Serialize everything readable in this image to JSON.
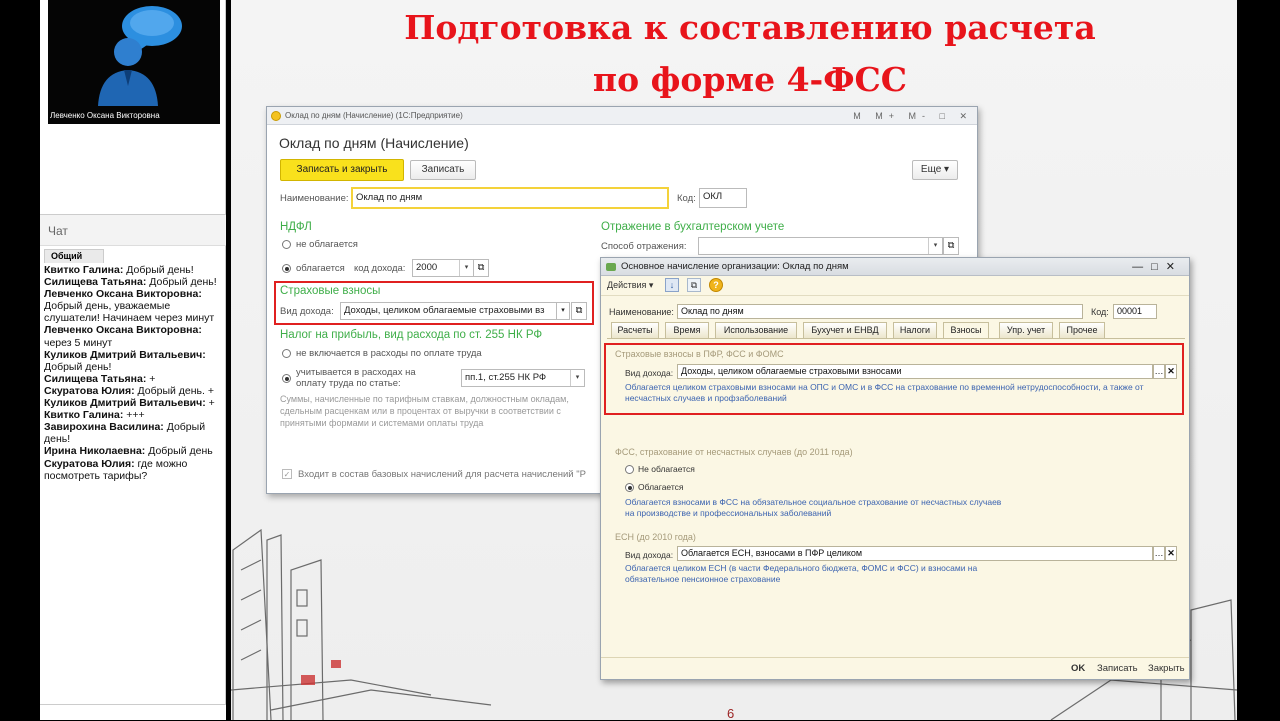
{
  "presenter": {
    "name": "Левченко Оксана Викторовна"
  },
  "chat": {
    "header": "Чат",
    "tab": "Общий",
    "messages": [
      {
        "author": "Квитко Галина:",
        "text": " Добрый день!"
      },
      {
        "author": "Силищева Татьяна:",
        "text": " Добрый день!"
      },
      {
        "author": "Левченко Оксана Викторовна:",
        "text": " Добрый день, уважаемые слушатели! Начинаем через  минут"
      },
      {
        "author": "Левченко Оксана Викторовна:",
        "text": " через 5 минут"
      },
      {
        "author": "Куликов Дмитрий Витальевич:",
        "text": " Добрый день!"
      },
      {
        "author": "Силищева Татьяна:",
        "text": " +"
      },
      {
        "author": "Скуратова Юлия:",
        "text": " Добрый день. +"
      },
      {
        "author": "Куликов Дмитрий Витальевич:",
        "text": " +"
      },
      {
        "author": "Квитко Галина:",
        "text": " +++"
      },
      {
        "author": "Завирохина Василина:",
        "text": " Добрый день!"
      },
      {
        "author": "Ирина    Николаевна:",
        "text": " Добрый день"
      },
      {
        "author": "Скуратова Юлия:",
        "text": " где можно посмотреть тарифы?"
      }
    ]
  },
  "slide": {
    "title_line1": "Подготовка к составлению расчета",
    "title_line2": "по форме 4-ФСС",
    "page_number": "6"
  },
  "win1": {
    "titlebar": "Оклад по дням (Начисление) (1С:Предприятие)",
    "titlebar_ctrls": "M M+ M- □ ✕",
    "header": "Оклад по дням (Начисление)",
    "save_close": "Записать и закрыть",
    "save": "Записать",
    "more": "Еще ▾",
    "name_label": "Наименование:",
    "name_value": "Оклад по дням",
    "code_label": "Код:",
    "code_value": "ОКЛ",
    "ndfl_title": "НДФЛ",
    "ndfl_opt1": "не облагается",
    "ndfl_opt2": "облагается",
    "income_code_label": "код дохода:",
    "income_code_value": "2000",
    "insurance_title": "Страховые взносы",
    "income_type_label": "Вид дохода:",
    "income_type_value": "Доходы, целиком облагаемые страховыми вз",
    "profit_tax_title": "Налог на прибыль, вид расхода по ст. 255 НК РФ",
    "profit_opt1": "не включается в расходы по оплате труда",
    "profit_opt2": "учитывается в расходах на оплату труда по статье:",
    "article_value": "пп.1, ст.255 НК РФ",
    "profit_note": "Суммы, начисленные по тарифным ставкам, должностным окладам, сдельным расценкам или в процентах от выручки в соответствии с принятыми формами и системами оплаты труда",
    "accounting_title": "Отражение в бухгалтерском учете",
    "accounting_label": "Способ отражения:",
    "base_checkbox": "Входит в состав базовых начислений для расчета начислений \"Р"
  },
  "win2": {
    "titlebar": "Основное начисление организации: Оклад по дням",
    "actions": "Действия ▾",
    "name_label": "Наименование:",
    "name_value": "Оклад по дням",
    "code_label": "Код:",
    "code_value": "00001",
    "tabs": [
      "Расчеты",
      "Время",
      "Использование",
      "Бухучет и ЕНВД",
      "Налоги",
      "Взносы",
      "Упр. учет",
      "Прочее"
    ],
    "active_tab": "Взносы",
    "sec1_title": "Страховые взносы в ПФР, ФСС и ФОМС",
    "sec1_label": "Вид дохода:",
    "sec1_value": "Доходы, целиком облагаемые страховыми взносами",
    "sec1_note": "Облагается целиком страховыми взносами на ОПС и ОМС и в ФСС на страхование по временной нетрудоспособности, а также от несчастных случаев и профзаболеваний",
    "sec2_title": "ФСС, страхование от несчастных случаев (до 2011 года)",
    "sec2_opt1": "Не облагается",
    "sec2_opt2": "Облагается",
    "sec2_note": "Облагается взносами в ФСС на обязательное социальное страхование от несчастных случаев на производстве и профессиональных заболеваний",
    "sec3_title": "ЕСН (до 2010 года)",
    "sec3_label": "Вид дохода:",
    "sec3_value": "Облагается ЕСН, взносами в ПФР целиком",
    "sec3_note": "Облагается целиком ЕСН (в части Федерального бюджета, ФОМС и ФСС) и взносами на обязательное пенсионное страхование",
    "ok": "OK",
    "save": "Записать",
    "close": "Закрыть"
  },
  "colors": {
    "title_red": "#e8141b",
    "redbox": "#e02020",
    "green": "#3fae49",
    "blue_note": "#3b63b0",
    "yellow_btn": "#f9e11c"
  }
}
